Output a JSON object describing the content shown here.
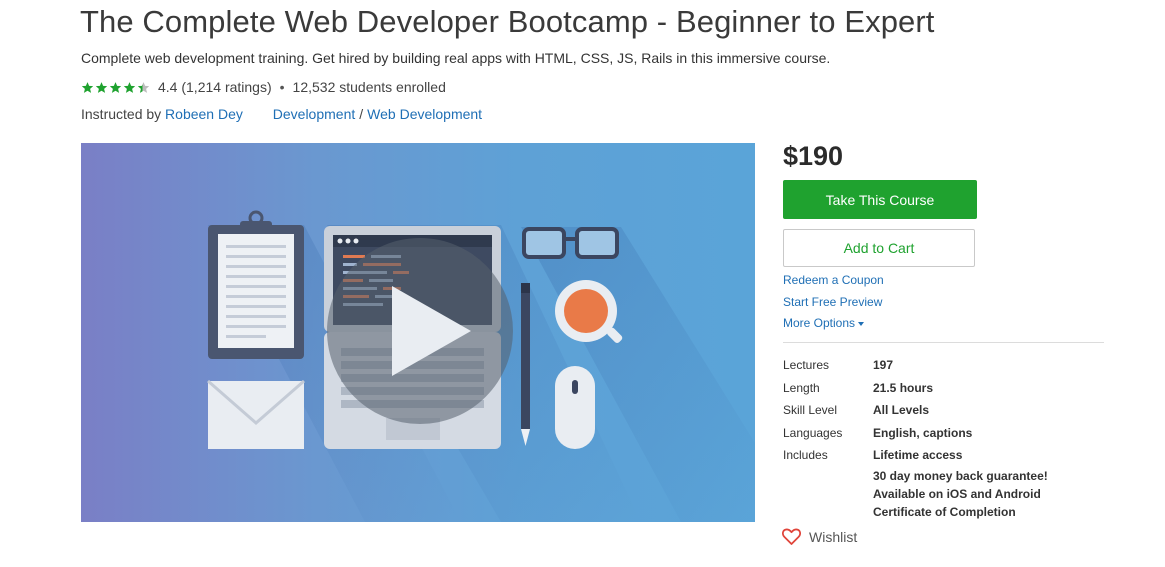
{
  "course": {
    "title": "The Complete Web Developer Bootcamp - Beginner to Expert",
    "subtitle": "Complete web development training. Get hired by building real apps with HTML, CSS, JS, Rails in this immersive course.",
    "rating_value": 4.4,
    "rating_text": "4.4 (1,214 ratings)",
    "bullet": "•",
    "students_text": "12,532 students enrolled",
    "instructed_by_label": "Instructed by",
    "instructor_name": "Robeen Dey",
    "category": "Development",
    "category_separator": "/",
    "subcategory": "Web Development"
  },
  "colors": {
    "accent_green": "#1fa22f",
    "link_blue": "#1f6fb5",
    "star_green": "#1fa22f",
    "star_empty": "#bdbdbd",
    "wishlist_red": "#e0443a"
  },
  "video": {
    "icon": "play-icon",
    "illustration": [
      "clipboard",
      "laptop",
      "glasses",
      "coffee-cup",
      "envelope",
      "pencil",
      "mouse"
    ]
  },
  "purchase": {
    "price": "$190",
    "take_course_label": "Take This Course",
    "add_to_cart_label": "Add to Cart",
    "redeem_coupon": "Redeem a Coupon",
    "free_preview": "Start Free Preview",
    "more_options": "More Options"
  },
  "details": {
    "lectures_label": "Lectures",
    "lectures_value": "197",
    "length_label": "Length",
    "length_value": "21.5 hours",
    "skill_label": "Skill Level",
    "skill_value": "All Levels",
    "languages_label": "Languages",
    "languages_value": "English, captions",
    "includes_label": "Includes",
    "includes": [
      "Lifetime access",
      "30 day money back guarantee!",
      "Available on iOS and Android",
      "Certificate of Completion"
    ]
  },
  "wishlist": {
    "label": "Wishlist",
    "icon": "heart-icon"
  }
}
